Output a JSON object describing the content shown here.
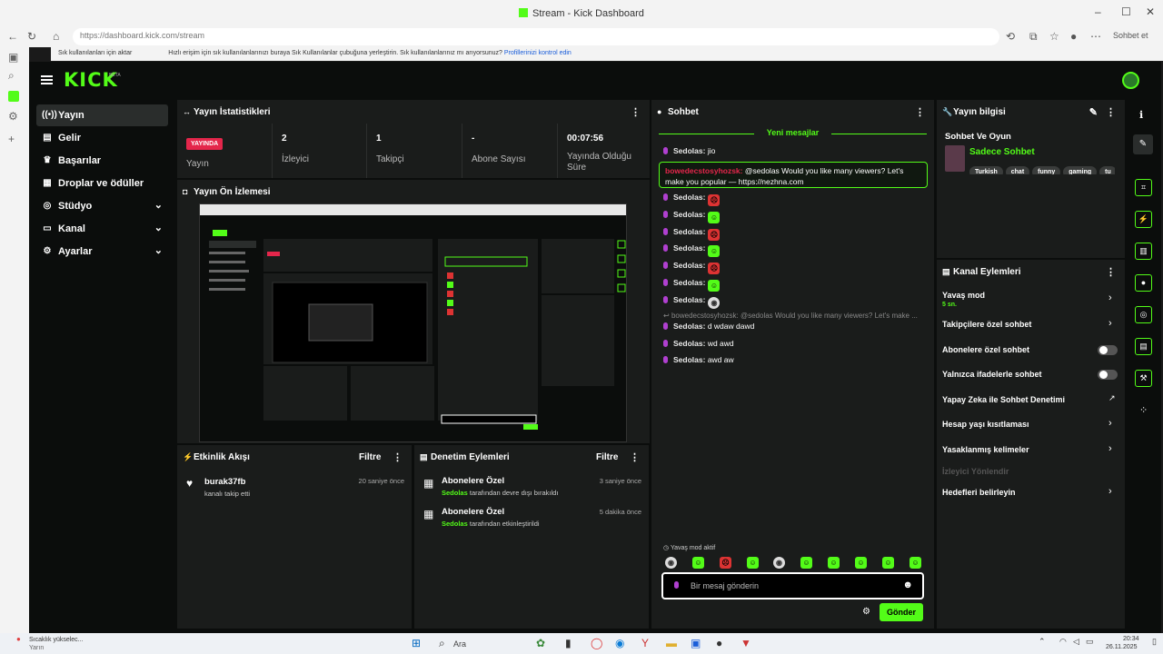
{
  "browser": {
    "title": "Stream - Kick Dashboard",
    "url": "https://dashboard.kick.com/stream",
    "profile_label": "Sohbet et",
    "bookmarks_label": "Sık kullanılanları için aktar",
    "bookmarks_hint": "Hızlı erişim için sık kullanılanlarınızı buraya Sık Kullanılanlar çubuğuna yerleştirin. Sık kullanılanlarınız mı arıyorsunuz?",
    "bookmarks_link": "Profillerinizi kontrol edin"
  },
  "app": {
    "logo": "KICK",
    "logo_badge": "BETA"
  },
  "sidebar": {
    "items": [
      {
        "label": "Yayın",
        "icon": "broadcast-icon"
      },
      {
        "label": "Gelir",
        "icon": "wallet-icon"
      },
      {
        "label": "Başarılar",
        "icon": "trophy-icon"
      },
      {
        "label": "Droplar ve ödüller",
        "icon": "gift-icon"
      },
      {
        "label": "Stüdyo",
        "icon": "studio-icon"
      },
      {
        "label": "Kanal",
        "icon": "tv-icon"
      },
      {
        "label": "Ayarlar",
        "icon": "gear-icon"
      }
    ]
  },
  "stats": {
    "title": "Yayın İstatistikleri",
    "status_badge": "YAYINDA",
    "status_label": "Yayın",
    "viewers_value": "2",
    "viewers_label": "İzleyici",
    "followers_value": "1",
    "followers_label": "Takipçi",
    "subs_value": "-",
    "subs_label": "Abone Sayısı",
    "uptime_value": "00:07:56",
    "uptime_label": "Yayında Olduğu Süre"
  },
  "preview": {
    "title": "Yayın Ön İzlemesi"
  },
  "activity": {
    "title": "Etkinlik Akışı",
    "filter": "Filtre",
    "items": [
      {
        "name": "burak37fb",
        "desc": "kanalı takip etti",
        "time": "20 saniye önce"
      }
    ]
  },
  "moderation": {
    "title": "Denetim Eylemleri",
    "filter": "Filtre",
    "items": [
      {
        "title": "Abonelere Özel",
        "user": "Sedolas",
        "desc": "tarafından devre dışı bırakıldı",
        "time": "3 saniye önce"
      },
      {
        "title": "Abonelere Özel",
        "user": "Sedolas",
        "desc": "tarafından etkinleştirildi",
        "time": "5 dakika önce"
      }
    ]
  },
  "chat": {
    "title": "Sohbet",
    "new_messages": "Yeni mesajlar",
    "messages": [
      {
        "user": "Sedolas:",
        "text": "jio"
      }
    ],
    "highlight": {
      "user": "bowedecstosyhozsk:",
      "text": "@sedolas Would you like many viewers? Let's make you popular — https://nezhna.com"
    },
    "emote_lines": [
      "Sedolas:",
      "Sedolas:",
      "Sedolas:",
      "Sedolas:",
      "Sedolas:",
      "Sedolas:",
      "Sedolas:"
    ],
    "deleted_line": "bowedecstosyhozsk: @sedolas Would you like many viewers? Let's make ...",
    "tail_messages": [
      {
        "user": "Sedolas:",
        "text": "d wdaw dawd"
      },
      {
        "user": "Sedolas:",
        "text": "wd awd"
      },
      {
        "user": "Sedolas:",
        "text": "awd aw"
      }
    ],
    "slow_mode_active": "Yavaş mod aktif",
    "input_placeholder": "Bir mesaj gönderin",
    "send_label": "Gönder"
  },
  "stream_info": {
    "title": "Yayın bilgisi",
    "stream_title": "Sohbet Ve Oyun",
    "category": "Sadece Sohbet",
    "tags": [
      "Turkish",
      "chat",
      "funny",
      "gaming",
      "tu"
    ]
  },
  "channel_actions": {
    "title": "Kanal Eylemleri",
    "slow_mode": "Yavaş mod",
    "slow_mode_value": "5 sn.",
    "followers_only": "Takipçilere özel sohbet",
    "subs_only": "Abonelere özel sohbet",
    "emotes_only": "Yalnızca ifadelerle sohbet",
    "ai_moderation": "Yapay Zeka ile Sohbet Denetimi",
    "age_restriction": "Hesap yaşı kısıtlaması",
    "banned_words": "Yasaklanmış kelimeler",
    "viewer_directs": "İzleyici Yönlendir",
    "set_goals": "Hedefleri belirleyin"
  },
  "taskbar": {
    "weather_title": "Sıcaklık yükselec...",
    "weather_sub": "Yarın",
    "search": "Ara",
    "time": "20:34",
    "date": "26.11.2025"
  }
}
